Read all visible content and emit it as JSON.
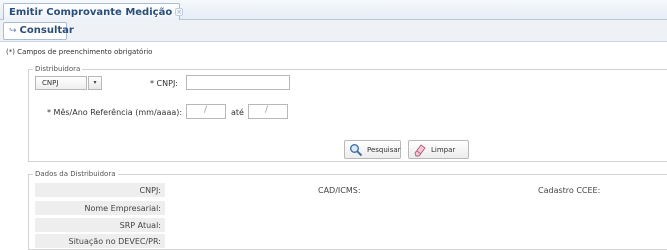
{
  "tabs": {
    "main_label": "Emitir Comprovante Medição",
    "close_icon": "×"
  },
  "toolbar": {
    "consultar_label": "Consultar",
    "consultar_icon": "↪"
  },
  "form": {
    "required_note": "(*) Campos de preenchimento obrigatório",
    "distribuidora_legend": "Distribuidora",
    "tipo_select": {
      "value": "CNPJ",
      "arrow": "▾"
    },
    "cnpj_label": "* CNPJ:",
    "cnpj_value": "",
    "mes_ano_label": "* Mês/Ano Referência (mm/aaaa):",
    "date_separator": "/",
    "ate_label": "até",
    "pesquisar_label": "Pesquisar",
    "limpar_label": "Limpar"
  },
  "dados": {
    "legend": "Dados da Distribuidora",
    "cnpj_label": "CNPJ:",
    "nome_empresarial_label": "Nome Empresarial:",
    "srp_atual_label": "SRP Atual:",
    "situacao_label": "Situação no DEVEC/PR:",
    "cad_icms_label": "CAD/ICMS:",
    "cadastro_ccee_label": "Cadastro CCEE:"
  },
  "colors": {
    "tab_text": "#2a4e78",
    "label_bg": "#eeeeee",
    "border": "#d3d3d3"
  }
}
